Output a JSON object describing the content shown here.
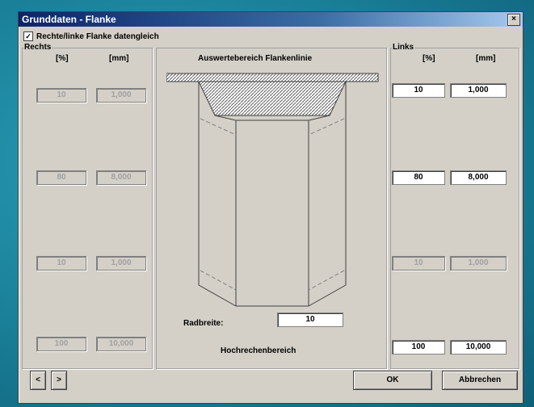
{
  "title": "Grunddaten - Flanke",
  "close_glyph": "×",
  "checkbox": {
    "checked_glyph": "✓",
    "label": "Rechte/linke Flanke datengleich"
  },
  "rechts": {
    "label": "Rechts",
    "col_percent": "[%]",
    "col_mm": "[mm]",
    "rows": [
      {
        "percent": "10",
        "mm": "1,000"
      },
      {
        "percent": "80",
        "mm": "8,000"
      },
      {
        "percent": "10",
        "mm": "1,000"
      },
      {
        "percent": "100",
        "mm": "10,000"
      }
    ]
  },
  "links": {
    "label": "Links",
    "col_percent": "[%]",
    "col_mm": "[mm]",
    "rows": [
      {
        "percent": "10",
        "mm": "1,000"
      },
      {
        "percent": "80",
        "mm": "8,000"
      },
      {
        "percent": "10",
        "mm": "1,000"
      },
      {
        "percent": "100",
        "mm": "10,000"
      }
    ]
  },
  "center": {
    "heading": "Auswertebereich Flankenlinie",
    "radbreite_label": "Radbreite:",
    "radbreite_value": "10",
    "footer": "Hochrechenbereich"
  },
  "buttons": {
    "prev": "<",
    "next": ">",
    "ok": "OK",
    "cancel": "Abbrechen"
  }
}
